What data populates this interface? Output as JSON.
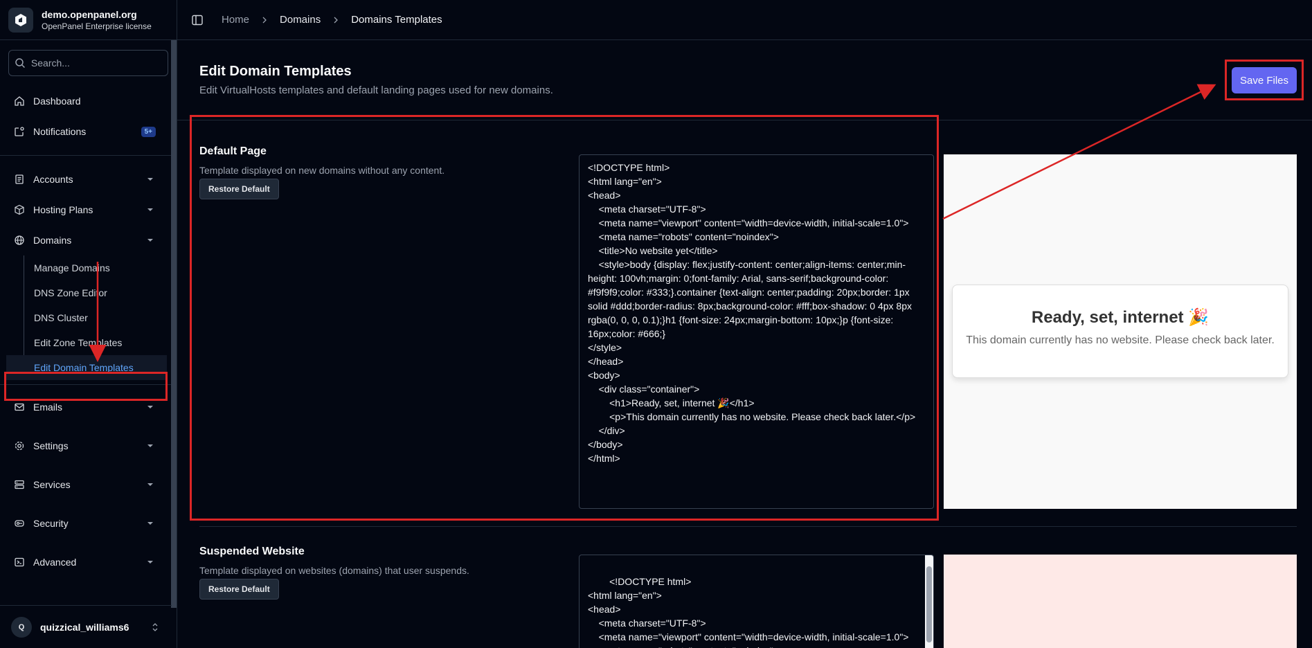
{
  "brand": {
    "name": "demo.openpanel.org",
    "license": "OpenPanel Enterprise license"
  },
  "search": {
    "placeholder": "Search..."
  },
  "nav": {
    "dashboard": "Dashboard",
    "notifications": "Notifications",
    "notifications_badge": "5+",
    "accounts": "Accounts",
    "hosting_plans": "Hosting Plans",
    "domains": "Domains",
    "domains_sub": [
      "Manage Domains",
      "DNS Zone Editor",
      "DNS Cluster",
      "Edit Zone Templates",
      "Edit Domain Templates"
    ],
    "emails": "Emails",
    "settings": "Settings",
    "services": "Services",
    "security": "Security",
    "advanced": "Advanced"
  },
  "user": {
    "initial": "Q",
    "name": "quizzical_williams6"
  },
  "breadcrumb": {
    "home": "Home",
    "domains": "Domains",
    "current": "Domains Templates"
  },
  "page": {
    "title": "Edit Domain Templates",
    "subtitle": "Edit VirtualHosts templates and default landing pages used for new domains.",
    "save_label": "Save Files"
  },
  "sections": [
    {
      "title": "Default Page",
      "desc": "Template displayed on new domains without any content.",
      "restore_label": "Restore Default",
      "code": "<!DOCTYPE html>\n<html lang=\"en\">\n<head>\n    <meta charset=\"UTF-8\">\n    <meta name=\"viewport\" content=\"width=device-width, initial-scale=1.0\">\n    <meta name=\"robots\" content=\"noindex\">\n    <title>No website yet</title>\n    <style>body {display: flex;justify-content: center;align-items: center;min-height: 100vh;margin: 0;font-family: Arial, sans-serif;background-color: #f9f9f9;color: #333;}.container {text-align: center;padding: 20px;border: 1px solid #ddd;border-radius: 8px;background-color: #fff;box-shadow: 0 4px 8px rgba(0, 0, 0, 0.1);}h1 {font-size: 24px;margin-bottom: 10px;}p {font-size: 16px;color: #666;}\n</style>\n</head>\n<body>\n    <div class=\"container\">\n        <h1>Ready, set, internet 🎉</h1>\n        <p>This domain currently has no website. Please check back later.</p>\n    </div>\n</body>\n</html>",
      "preview_heading": "Ready, set, internet 🎉",
      "preview_text": "This domain currently has no website. Please check back later.",
      "preview_bg": "#f9f9f9"
    },
    {
      "title": "Suspended Website",
      "desc": "Template displayed on websites (domains) that user suspends.",
      "restore_label": "Restore Default",
      "code": "<!DOCTYPE html>\n<html lang=\"en\">\n<head>\n    <meta charset=\"UTF-8\">\n    <meta name=\"viewport\" content=\"width=device-width, initial-scale=1.0\">\n    <meta name=\"robots\" content=\"noindex\">",
      "preview_bg": "#fee9e7"
    }
  ],
  "colors": {
    "accent": "#6366f1",
    "highlight": "#dc2626",
    "link": "#60a5fa"
  }
}
